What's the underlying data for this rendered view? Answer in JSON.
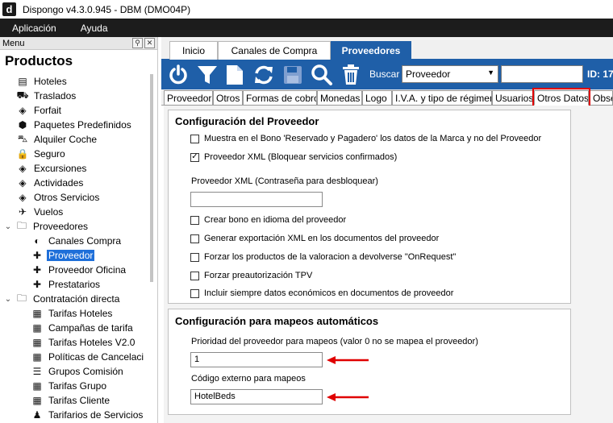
{
  "window": {
    "title": "Dispongo v4.3.0.945 - DBM (DMO04P)",
    "logo_letter": "d"
  },
  "menubar": {
    "items": [
      "Aplicación",
      "Ayuda"
    ]
  },
  "left_panel": {
    "header": "Menu",
    "section_title": "Productos",
    "items": [
      {
        "label": "Hoteles",
        "icon": "hotel-icon",
        "level": 0
      },
      {
        "label": "Traslados",
        "icon": "bus-icon",
        "level": 0
      },
      {
        "label": "Forfait",
        "icon": "ticket-icon",
        "level": 0
      },
      {
        "label": "Paquetes Predefinidos",
        "icon": "package-icon",
        "level": 0
      },
      {
        "label": "Alquiler Coche",
        "icon": "car-icon",
        "level": 0
      },
      {
        "label": "Seguro",
        "icon": "lock-icon",
        "level": 0
      },
      {
        "label": "Excursiones",
        "icon": "ticket-icon",
        "level": 0
      },
      {
        "label": "Actividades",
        "icon": "ticket-icon",
        "level": 0
      },
      {
        "label": "Otros Servicios",
        "icon": "ticket-icon",
        "level": 0
      },
      {
        "label": "Vuelos",
        "icon": "plane-icon",
        "level": 0
      },
      {
        "label": "Proveedores",
        "icon": "folder-icon",
        "level": "folder"
      },
      {
        "label": "Canales Compra",
        "icon": "channel-icon",
        "level": 1
      },
      {
        "label": "Proveedor",
        "icon": "puzzle-icon",
        "level": 1,
        "selected": true
      },
      {
        "label": "Proveedor Oficina",
        "icon": "puzzle-icon",
        "level": 1
      },
      {
        "label": "Prestatarios",
        "icon": "puzzle-icon",
        "level": 1
      },
      {
        "label": "Contratación directa",
        "icon": "folder-icon",
        "level": "folder"
      },
      {
        "label": "Tarifas Hoteles",
        "icon": "calendar-icon",
        "level": 1
      },
      {
        "label": "Campañas de tarifa",
        "icon": "calendar-icon",
        "level": 1
      },
      {
        "label": "Tarifas Hoteles V2.0",
        "icon": "calendar-icon",
        "level": 1
      },
      {
        "label": "Políticas de Cancelaci",
        "icon": "calendar-icon",
        "level": 1
      },
      {
        "label": "Grupos Comisión",
        "icon": "list-icon",
        "level": 1
      },
      {
        "label": "Tarifas Grupo",
        "icon": "calendar-icon",
        "level": 1
      },
      {
        "label": "Tarifas Cliente",
        "icon": "calendar-icon",
        "level": 1
      },
      {
        "label": "Tarifarios de Servicios",
        "icon": "person-icon",
        "level": 1
      }
    ]
  },
  "top_tabs": [
    {
      "label": "Inicio"
    },
    {
      "label": "Canales de Compra"
    },
    {
      "label": "Proveedores",
      "active": true
    }
  ],
  "toolbar": {
    "icons": [
      "power-icon",
      "filter-icon",
      "new-document-icon",
      "refresh-icon",
      "save-icon",
      "search-icon",
      "delete-icon"
    ],
    "buscar_label": "Buscar",
    "buscar_select_value": "Proveedor",
    "buscar_input_value": "",
    "id_label": "ID: 17"
  },
  "sub_tabs": [
    {
      "label": "Proveedor"
    },
    {
      "label": "Otros"
    },
    {
      "label": "Formas de cobro"
    },
    {
      "label": "Monedas"
    },
    {
      "label": "Logo"
    },
    {
      "label": "I.V.A. y tipo de régimen"
    },
    {
      "label": "Usuarios"
    },
    {
      "label": "Otros Datos",
      "active": true
    },
    {
      "label": "Obse"
    }
  ],
  "config_proveedor": {
    "title": "Configuración del Proveedor",
    "checks": [
      {
        "label": "Muestra en el Bono 'Reservado y Pagadero' los datos de la Marca y no del Proveedor",
        "checked": false
      },
      {
        "label": "Proveedor XML (Bloquear servicios confirmados)",
        "checked": true
      }
    ],
    "xml_password_label": "Proveedor XML (Contraseña para desbloquear)",
    "xml_password_value": "",
    "checks2": [
      {
        "label": "Crear bono en idioma del proveedor",
        "checked": false
      },
      {
        "label": "Generar exportación XML en los documentos del proveedor",
        "checked": false
      },
      {
        "label": "Forzar los productos de la valoracion a devolverse \"OnRequest\"",
        "checked": false
      },
      {
        "label": "Forzar preautorización TPV",
        "checked": false
      },
      {
        "label": "Incluir siempre datos económicos en documentos de proveedor",
        "checked": false
      }
    ]
  },
  "config_mapeos": {
    "title": "Configuración para mapeos automáticos",
    "priority_label": "Prioridad del proveedor para mapeos (valor 0 no se mapea el proveedor)",
    "priority_value": "1",
    "code_label": "Código externo para mapeos",
    "code_value": "HotelBeds"
  }
}
